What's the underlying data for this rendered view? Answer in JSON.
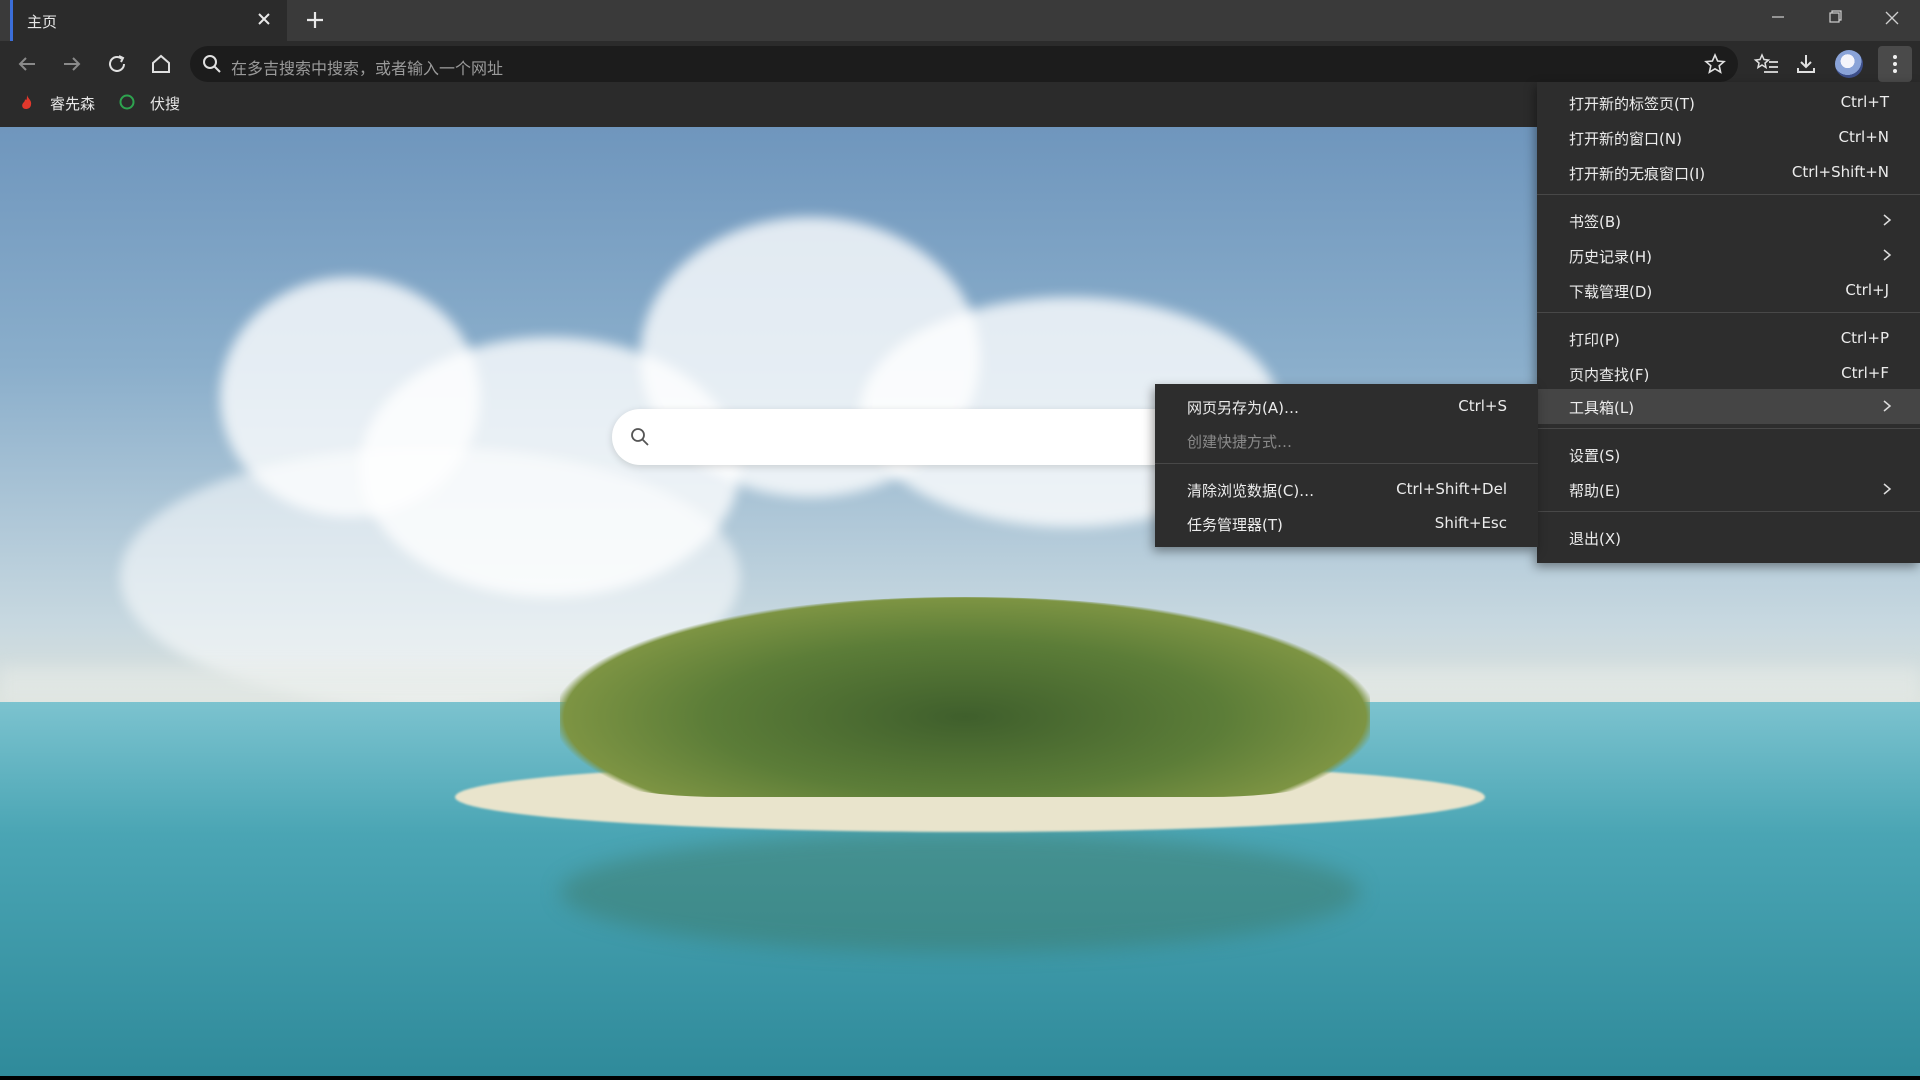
{
  "tabs": [
    {
      "title": "主页"
    }
  ],
  "toolbar": {
    "address_placeholder": "在多吉搜索中搜索，或者输入一个网址"
  },
  "bookmarks": [
    {
      "label": "睿先森",
      "icon": "flame-icon",
      "color": "#e2382c"
    },
    {
      "label": "伏搜",
      "icon": "circle-logo-icon",
      "color": "#2ea44f"
    }
  ],
  "main_menu": {
    "items": [
      {
        "label": "打开新的标签页(T)",
        "shortcut": "Ctrl+T"
      },
      {
        "label": "打开新的窗口(N)",
        "shortcut": "Ctrl+N"
      },
      {
        "label": "打开新的无痕窗口(I)",
        "shortcut": "Ctrl+Shift+N"
      },
      {
        "label": "书签(B)",
        "submenu": true
      },
      {
        "label": "历史记录(H)",
        "submenu": true
      },
      {
        "label": "下载管理(D)",
        "shortcut": "Ctrl+J"
      },
      {
        "label": "打印(P)",
        "shortcut": "Ctrl+P"
      },
      {
        "label": "页内查找(F)",
        "shortcut": "Ctrl+F"
      },
      {
        "label": "工具箱(L)",
        "submenu": true,
        "active": true
      },
      {
        "label": "设置(S)"
      },
      {
        "label": "帮助(E)",
        "submenu": true
      },
      {
        "label": "退出(X)"
      }
    ]
  },
  "tools_submenu": {
    "items": [
      {
        "label": "网页另存为(A)…",
        "shortcut": "Ctrl+S"
      },
      {
        "label": "创建快捷方式…",
        "disabled": true
      },
      {
        "label": "清除浏览数据(C)…",
        "shortcut": "Ctrl+Shift+Del"
      },
      {
        "label": "任务管理器(T)",
        "shortcut": "Shift+Esc"
      }
    ]
  },
  "colors": {
    "tab_accent": "#3b6ed8",
    "menu_bg": "#2d2d2d",
    "menu_active": "#454545"
  }
}
